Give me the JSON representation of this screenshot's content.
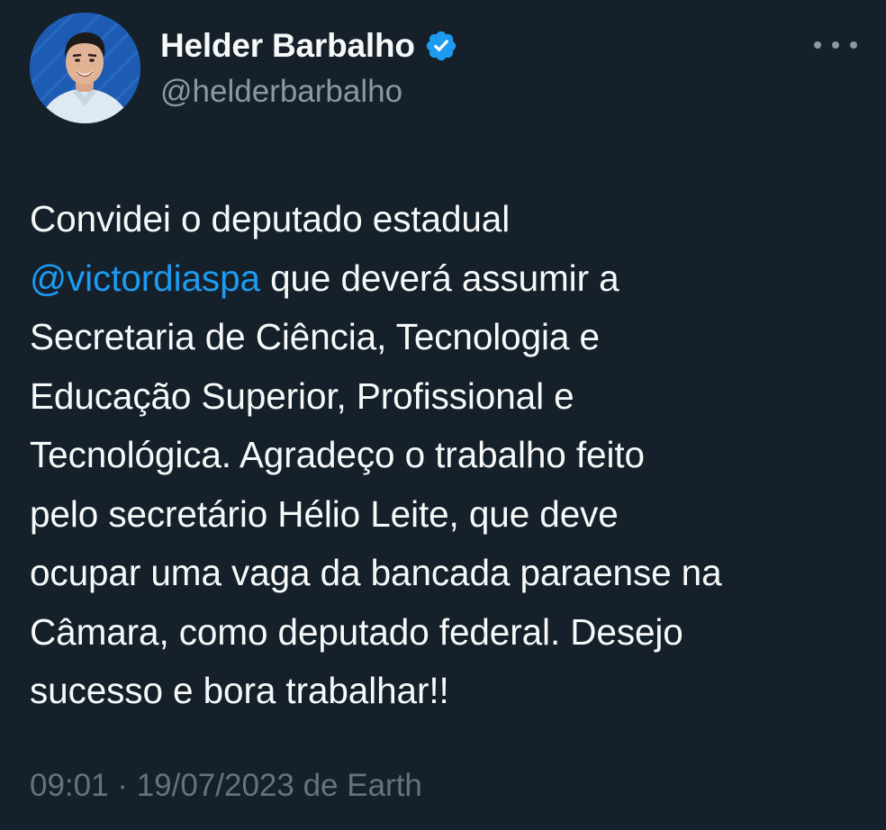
{
  "author": {
    "display_name": "Helder Barbalho",
    "handle": "@helderbarbalho",
    "verified": true
  },
  "tweet": {
    "lines": [
      {
        "text": "Convidei o deputado estadual"
      },
      {
        "mention": "@victordiaspa",
        "text": " que deverá assumir a"
      },
      {
        "text": "Secretaria de Ciência, Tecnologia e"
      },
      {
        "text": "Educação Superior, Profissional e"
      },
      {
        "text": "Tecnológica. Agradeço o trabalho feito"
      },
      {
        "text": "pelo secretário Hélio Leite, que deve"
      },
      {
        "text": "ocupar uma vaga da bancada paraense na"
      },
      {
        "text": "Câmara, como deputado federal. Desejo"
      },
      {
        "text": "sucesso e bora trabalhar!!"
      }
    ],
    "timestamp": "09:01 · 19/07/2023 de Earth"
  },
  "colors": {
    "background": "#15202b",
    "text": "#f7f9f9",
    "secondary": "#8b98a5",
    "link": "#1d9bf0",
    "verified": "#1d9bf0"
  },
  "icons": {
    "verified": "verified-badge-icon",
    "more": "more-options-icon"
  }
}
